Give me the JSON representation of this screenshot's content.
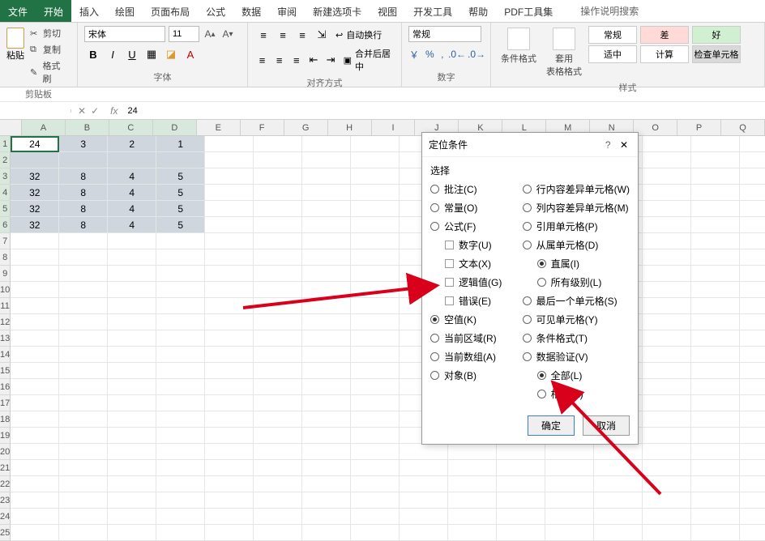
{
  "tabs": {
    "file": "文件",
    "start": "开始",
    "insert": "插入",
    "draw": "绘图",
    "layout": "页面布局",
    "formula": "公式",
    "data": "数据",
    "review": "审阅",
    "newtab": "新建选项卡",
    "view": "视图",
    "dev": "开发工具",
    "help": "帮助",
    "pdf": "PDF工具集",
    "search": "操作说明搜索"
  },
  "clipboard": {
    "paste": "粘贴",
    "cut": "剪切",
    "copy": "复制",
    "format_painter": "格式刷",
    "group": "剪贴板"
  },
  "font": {
    "name": "宋体",
    "size": "11",
    "group": "字体"
  },
  "alignment": {
    "wrap": "自动换行",
    "merge": "合并后居中",
    "group": "对齐方式"
  },
  "number": {
    "format": "常规",
    "group": "数字"
  },
  "styles": {
    "cond": "条件格式",
    "table": "套用\n表格格式",
    "normal": "常规",
    "good": "差",
    "hao": "好",
    "shizhong": "适中",
    "jisuan": "计算",
    "check": "检查单元格",
    "group": "样式"
  },
  "fx": {
    "value": "24"
  },
  "columns": [
    "A",
    "B",
    "C",
    "D",
    "E",
    "F",
    "G",
    "H",
    "I",
    "J",
    "K",
    "L",
    "M",
    "N",
    "O",
    "P",
    "Q"
  ],
  "rows_count": 25,
  "sheet_data": [
    [
      "24",
      "3",
      "2",
      "1"
    ],
    [
      "",
      "",
      "",
      ""
    ],
    [
      "32",
      "8",
      "4",
      "5"
    ],
    [
      "32",
      "8",
      "4",
      "5"
    ],
    [
      "32",
      "8",
      "4",
      "5"
    ],
    [
      "32",
      "8",
      "4",
      "5"
    ]
  ],
  "dialog": {
    "title": "定位条件",
    "section": "选择",
    "left": [
      {
        "label": "批注(C)",
        "type": "radio"
      },
      {
        "label": "常量(O)",
        "type": "radio"
      },
      {
        "label": "公式(F)",
        "type": "radio"
      },
      {
        "label": "数字(U)",
        "type": "check",
        "sub": true
      },
      {
        "label": "文本(X)",
        "type": "check",
        "sub": true
      },
      {
        "label": "逻辑值(G)",
        "type": "check",
        "sub": true
      },
      {
        "label": "错误(E)",
        "type": "check",
        "sub": true
      },
      {
        "label": "空值(K)",
        "type": "radio",
        "checked": true
      },
      {
        "label": "当前区域(R)",
        "type": "radio"
      },
      {
        "label": "当前数组(A)",
        "type": "radio"
      },
      {
        "label": "对象(B)",
        "type": "radio"
      }
    ],
    "right": [
      {
        "label": "行内容差异单元格(W)",
        "type": "radio"
      },
      {
        "label": "列内容差异单元格(M)",
        "type": "radio"
      },
      {
        "label": "引用单元格(P)",
        "type": "radio"
      },
      {
        "label": "从属单元格(D)",
        "type": "radio"
      },
      {
        "label": "直属(I)",
        "type": "radio",
        "sub": true,
        "checked": true
      },
      {
        "label": "所有级别(L)",
        "type": "radio",
        "sub": true
      },
      {
        "label": "最后一个单元格(S)",
        "type": "radio"
      },
      {
        "label": "可见单元格(Y)",
        "type": "radio"
      },
      {
        "label": "条件格式(T)",
        "type": "radio"
      },
      {
        "label": "数据验证(V)",
        "type": "radio"
      },
      {
        "label": "全部(L)",
        "type": "radio",
        "sub": true,
        "checked": true
      },
      {
        "label": "相同(E)",
        "type": "radio",
        "sub": true
      }
    ],
    "ok": "确定",
    "cancel": "取消"
  }
}
